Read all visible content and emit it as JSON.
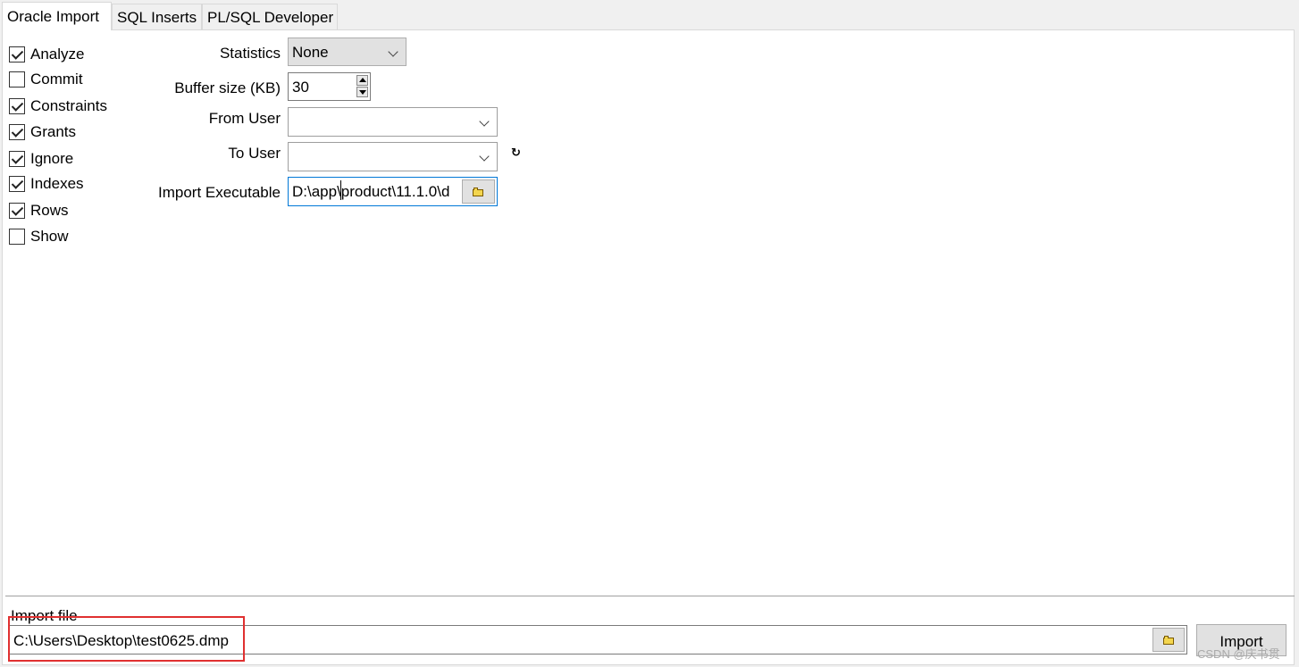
{
  "tabs": [
    {
      "label": "Oracle Import",
      "active": true
    },
    {
      "label": "SQL Inserts",
      "active": false
    },
    {
      "label": "PL/SQL Developer",
      "active": false
    }
  ],
  "options": [
    {
      "label": "Analyze",
      "checked": true
    },
    {
      "label": "Commit",
      "checked": false
    },
    {
      "label": "Constraints",
      "checked": true
    },
    {
      "label": "Grants",
      "checked": true
    },
    {
      "label": "Ignore",
      "checked": true
    },
    {
      "label": "Indexes",
      "checked": true
    },
    {
      "label": "Rows",
      "checked": true
    },
    {
      "label": "Show",
      "checked": false
    }
  ],
  "form": {
    "statistics_label": "Statistics",
    "statistics_value": "None",
    "buffer_label": "Buffer size (KB)",
    "buffer_value": "30",
    "from_user_label": "From User",
    "from_user_value": "",
    "to_user_label": "To User",
    "to_user_value": "",
    "executable_label": "Import Executable",
    "executable_value": "D:\\app\\product\\11.1.0\\d"
  },
  "import": {
    "file_label": "Import file",
    "file_value": "C:\\Users\\Desktop\\test0625.dmp",
    "button_label": "Import"
  },
  "watermark": "CSDN @庆书贯"
}
